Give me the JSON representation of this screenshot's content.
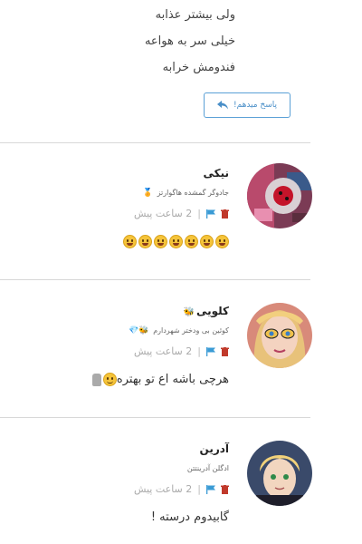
{
  "top_lines": [
    "ولی بیشتر عذابه",
    "خیلی سر به هواعه",
    "فندومش خرابه"
  ],
  "reply_button": {
    "label": "پاسخ میدهم!"
  },
  "comments": [
    {
      "name": "نیکی",
      "name_badge": "",
      "title": "جادوگر گمشده هاگوارتز",
      "title_badge": "🏅",
      "time": "2 ساعت پیش",
      "text": "",
      "emoji_count": 7
    },
    {
      "name": "کلویی",
      "name_badge": "🐝",
      "title": "کوئین بی ودختر شهردارم",
      "title_badge": "🐝💎",
      "time": "2 ساعت پیش",
      "text": "هرچی باشه اع تو بهتره",
      "emoji_count": 1
    },
    {
      "name": "آدرین",
      "name_badge": "",
      "title": "ادگلن آدرینتتن",
      "title_badge": "",
      "time": "2 ساعت پیش",
      "text": "گابیدوم درسته !",
      "emoji_count": 0
    }
  ],
  "colors": {
    "accent": "#4a8fc8",
    "trash": "#c0392b",
    "flag": "#3a9bd5",
    "divider": "#d8d8d8"
  }
}
